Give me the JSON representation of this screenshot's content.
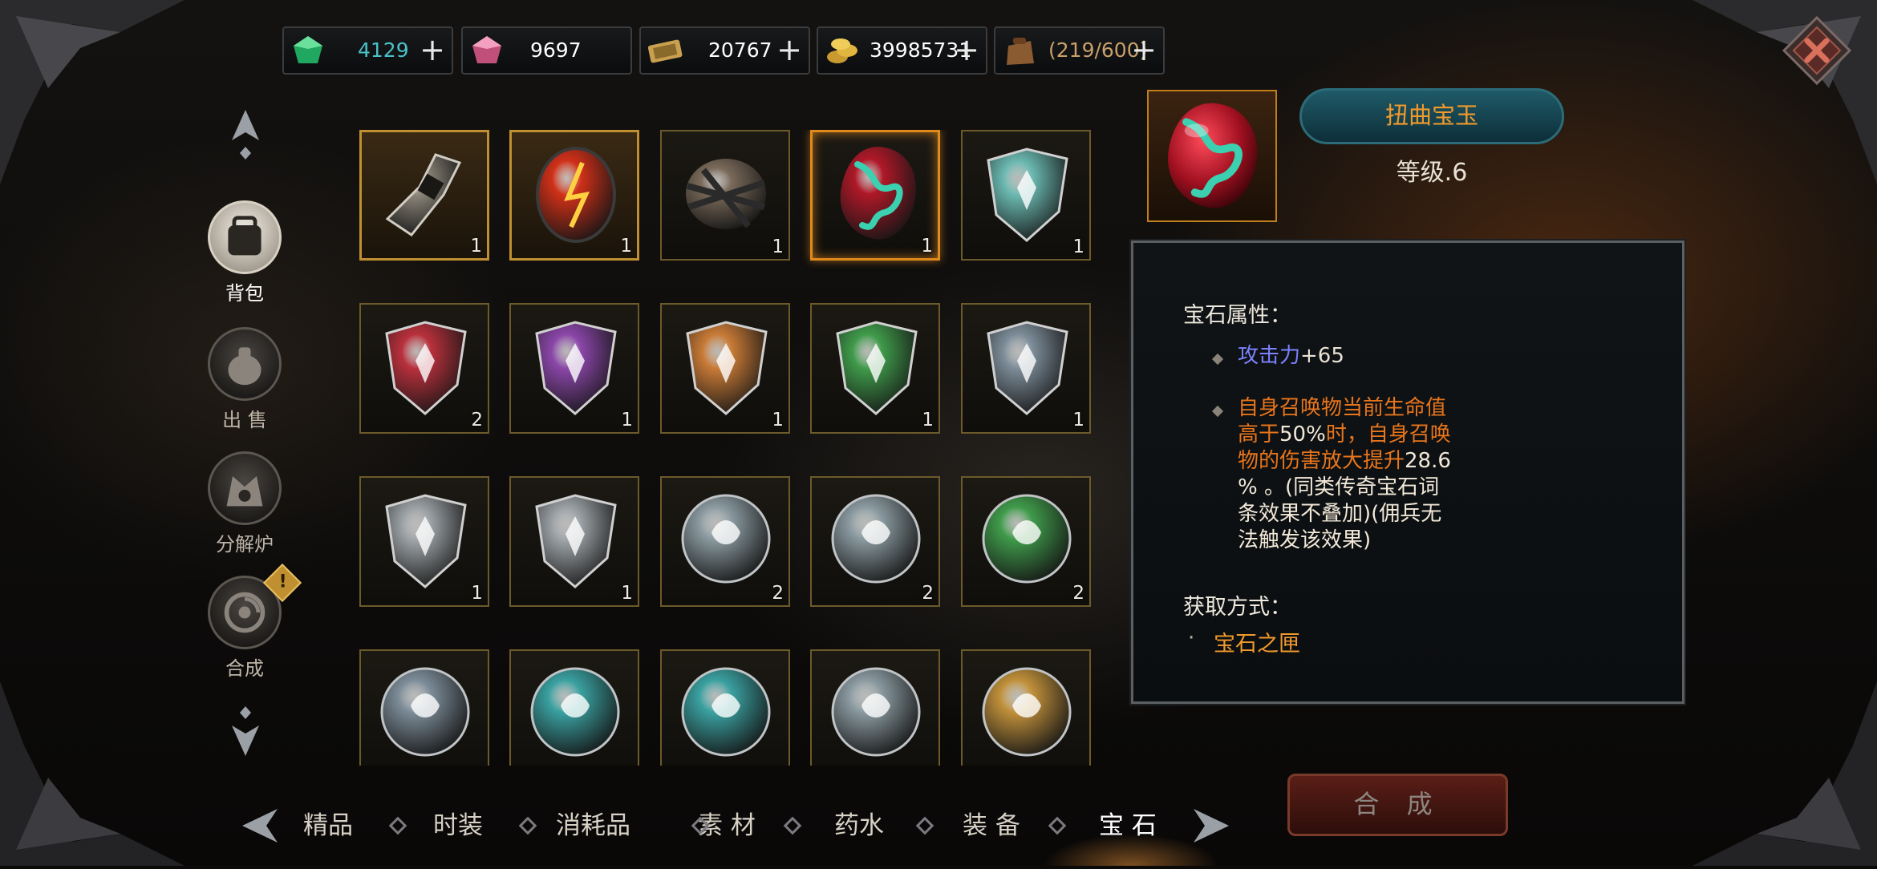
{
  "currencies": [
    {
      "value": "4129",
      "color": "#49c2c8",
      "icon": "green-gem-icon",
      "has_plus": true
    },
    {
      "value": "9697",
      "color": "#ffffff",
      "icon": "pink-gem-icon",
      "has_plus": false
    },
    {
      "value": "20767",
      "color": "#ffffff",
      "icon": "ticket-icon",
      "has_plus": true
    },
    {
      "value": "39985731",
      "color": "#ffffff",
      "icon": "gold-coins-icon",
      "has_plus": true
    },
    {
      "value": "(219/600)",
      "color": "#c9a06a",
      "icon": "bag-capacity-icon",
      "has_plus": true
    }
  ],
  "side_menu": [
    {
      "label": "背包",
      "icon": "backpack-icon",
      "active": true
    },
    {
      "label": "出 售",
      "icon": "money-bag-icon",
      "active": false
    },
    {
      "label": "分解炉",
      "icon": "furnace-icon",
      "active": false
    },
    {
      "label": "合成",
      "icon": "synthesis-icon",
      "active": false,
      "alert": "!"
    }
  ],
  "grid": [
    {
      "count": "1",
      "gem": "relic",
      "color": "#8a8478"
    },
    {
      "count": "1",
      "gem": "oval",
      "color": "#d03018"
    },
    {
      "count": "1",
      "gem": "chained-stone",
      "color": "#7a6a5a"
    },
    {
      "count": "1",
      "gem": "twisted-jade",
      "color": "#b01828"
    },
    {
      "count": "1",
      "gem": "shield",
      "color": "#6ab8b0"
    },
    {
      "count": "2",
      "gem": "shield",
      "color": "#b8303c"
    },
    {
      "count": "1",
      "gem": "shield",
      "color": "#8a46a8"
    },
    {
      "count": "1",
      "gem": "shield",
      "color": "#c87a36"
    },
    {
      "count": "1",
      "gem": "shield",
      "color": "#3f9a4a"
    },
    {
      "count": "1",
      "gem": "shield",
      "color": "#7c8c98"
    },
    {
      "count": "1",
      "gem": "shield",
      "color": "#9aa0a4"
    },
    {
      "count": "1",
      "gem": "shield",
      "color": "#9aa0a4"
    },
    {
      "count": "2",
      "gem": "round",
      "color": "#8a9aa0"
    },
    {
      "count": "2",
      "gem": "round",
      "color": "#8a9aa0"
    },
    {
      "count": "2",
      "gem": "round",
      "color": "#3f9a4a"
    },
    {
      "count": "",
      "gem": "round",
      "color": "#7c8c98"
    },
    {
      "count": "",
      "gem": "round",
      "color": "#3aa0a0"
    },
    {
      "count": "",
      "gem": "round",
      "color": "#3aa0a0"
    },
    {
      "count": "",
      "gem": "round",
      "color": "#8a9aa0"
    },
    {
      "count": "",
      "gem": "round",
      "color": "#c0903a"
    }
  ],
  "selected_index": 3,
  "detail": {
    "name": "扭曲宝玉",
    "level": "等级.6",
    "attr_title": "宝石属性：",
    "attack_label": "攻击力",
    "attack_value": "+65",
    "effect_lines": [
      [
        [
          "自身召唤物当前生命值",
          "#e8751c"
        ]
      ],
      [
        [
          "高于",
          "#e8751c"
        ],
        [
          "50%",
          "#f2e8d8"
        ],
        [
          "时，自身召唤",
          "#e8751c"
        ]
      ],
      [
        [
          "物的伤害放大提升",
          "#e8751c"
        ],
        [
          "28.6",
          "#f2e8d8"
        ]
      ],
      [
        [
          "% 。(同类传奇宝石词",
          "#f2e8d8"
        ]
      ],
      [
        [
          "条效果不叠加)(佣兵无",
          "#f2e8d8"
        ]
      ],
      [
        [
          "法触发该效果)",
          "#f2e8d8"
        ]
      ]
    ],
    "source_title": "获取方式：",
    "source_bullet": "·",
    "source": "宝石之匣"
  },
  "craft_button": "合 成",
  "tabs": [
    {
      "label": "精品",
      "active": false
    },
    {
      "label": "时装",
      "active": false
    },
    {
      "label": "消耗品",
      "active": false
    },
    {
      "label": "素 材",
      "active": false
    },
    {
      "label": "药水",
      "active": false
    },
    {
      "label": "装 备",
      "active": false
    },
    {
      "label": "宝 石",
      "active": true
    }
  ],
  "colors": {
    "accent": "#f09a2c",
    "attack": "#7b82ff",
    "effect": "#e8751c",
    "source": "#f09a2c"
  }
}
